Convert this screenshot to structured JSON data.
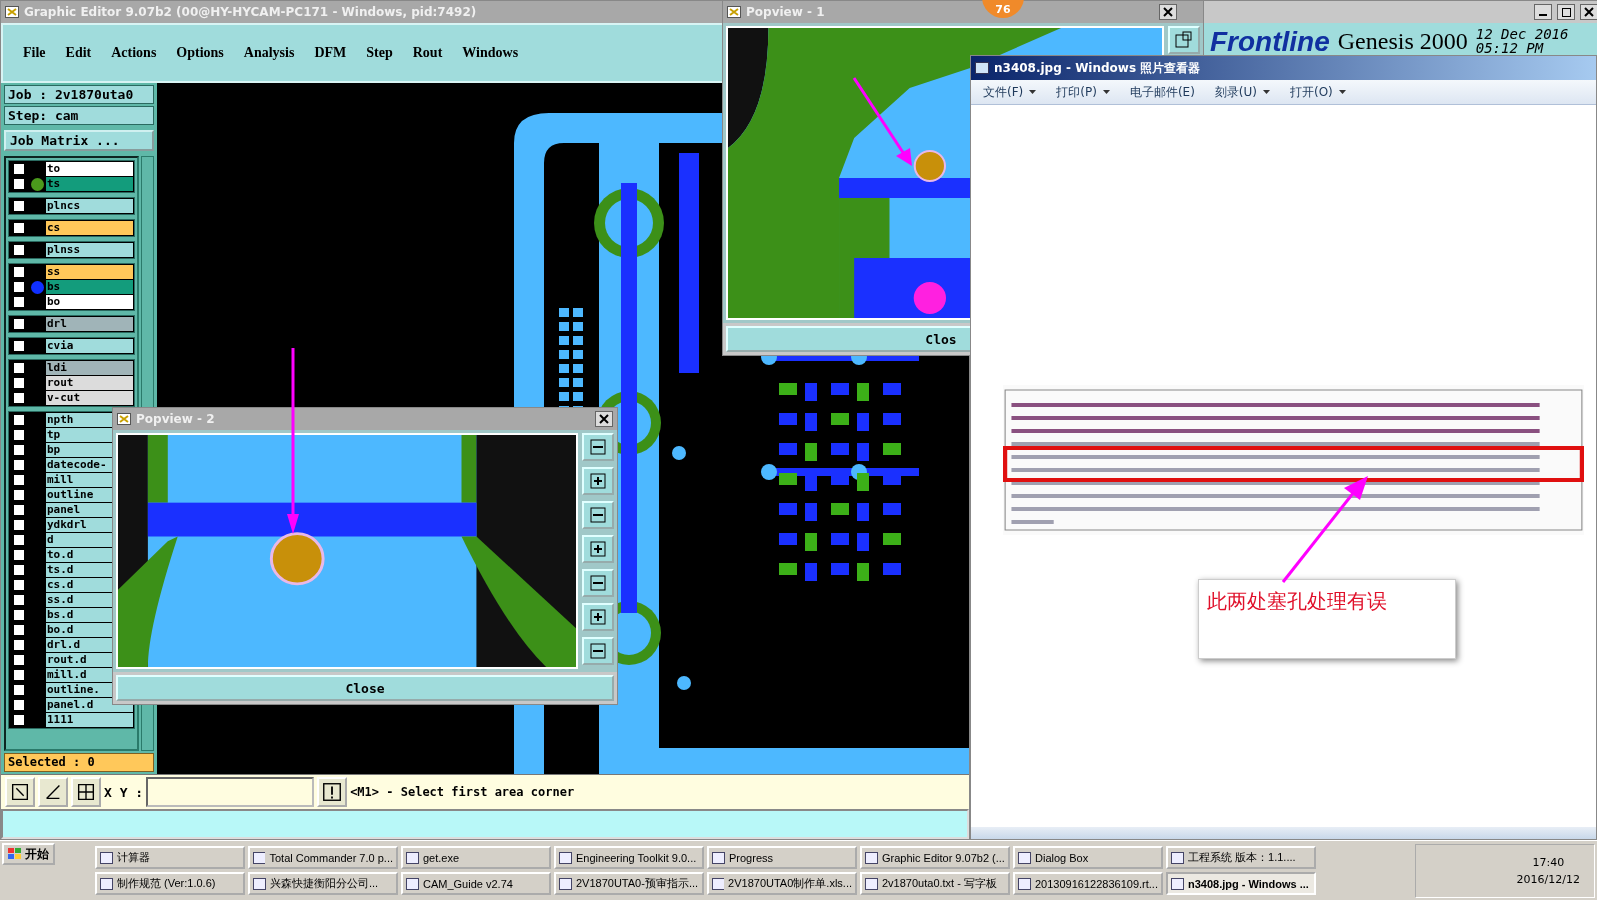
{
  "main_window": {
    "title": "Graphic Editor 9.07b2 (00@HY-HYCAM-PC171 - Windows, pid:7492)",
    "menu": [
      "File",
      "Edit",
      "Actions",
      "Options",
      "Analysis",
      "DFM",
      "Step",
      "Rout",
      "Windows"
    ],
    "job": "Job : 2v1870uta0",
    "step": "Step: cam",
    "job_matrix_button": "Job Matrix ...",
    "layer_groups": [
      {
        "layers": [
          {
            "name": "to",
            "color": "#ffffff",
            "checked": false
          },
          {
            "name": "ts",
            "color": "#139c7c",
            "checked": false,
            "marker": {
              "color": "#4a9a1c"
            }
          }
        ]
      },
      {
        "layers": [
          {
            "name": "plncs",
            "color": "#a0dcdc",
            "checked": false
          }
        ]
      },
      {
        "layers": [
          {
            "name": "cs",
            "color": "#ffc85a",
            "checked": false
          }
        ]
      },
      {
        "layers": [
          {
            "name": "plnss",
            "color": "#a0dcdc",
            "checked": false
          }
        ]
      },
      {
        "layers": [
          {
            "name": "ss",
            "color": "#ffc85a",
            "checked": false
          },
          {
            "name": "bs",
            "color": "#139c7c",
            "checked": false,
            "marker": {
              "color": "#1030ff"
            }
          },
          {
            "name": "bo",
            "color": "#ffffff",
            "checked": false
          }
        ]
      },
      {
        "layers": [
          {
            "name": "drl",
            "color": "#a0b4b8",
            "checked": false
          }
        ]
      },
      {
        "layers": [
          {
            "name": "cvia",
            "color": "#a0dcdc",
            "checked": false
          }
        ]
      },
      {
        "layers": [
          {
            "name": "ldi",
            "color": "#a0b4b8",
            "checked": false
          },
          {
            "name": "rout",
            "color": "#dcdcdc",
            "checked": false
          },
          {
            "name": "v-cut",
            "color": "#dcdcdc",
            "checked": false
          }
        ]
      },
      {
        "layers": [
          {
            "name": "npth",
            "color": "#a0dcdc",
            "checked": false
          },
          {
            "name": "tp",
            "color": "#a0dcdc",
            "checked": false
          },
          {
            "name": "bp",
            "color": "#a0dcdc",
            "checked": false
          },
          {
            "name": "datecode-",
            "color": "#a0dcdc",
            "checked": false
          },
          {
            "name": "mill",
            "color": "#a0dcdc",
            "checked": false
          },
          {
            "name": "outline",
            "color": "#a0dcdc",
            "checked": false
          },
          {
            "name": "panel",
            "color": "#a0dcdc",
            "checked": false
          },
          {
            "name": "ydkdrl",
            "color": "#a0dcdc",
            "checked": false
          },
          {
            "name": "d",
            "color": "#a0dcdc",
            "checked": false
          },
          {
            "name": "to.d",
            "color": "#a0dcdc",
            "checked": false
          },
          {
            "name": "ts.d",
            "color": "#a0dcdc",
            "checked": false
          },
          {
            "name": "cs.d",
            "color": "#a0dcdc",
            "checked": false
          },
          {
            "name": "ss.d",
            "color": "#a0dcdc",
            "checked": false
          },
          {
            "name": "bs.d",
            "color": "#a0dcdc",
            "checked": false
          },
          {
            "name": "bo.d",
            "color": "#a0dcdc",
            "checked": false
          },
          {
            "name": "drl.d",
            "color": "#a0dcdc",
            "checked": false
          },
          {
            "name": "rout.d",
            "color": "#a0dcdc",
            "checked": false
          },
          {
            "name": "mill.d",
            "color": "#a0dcdc",
            "checked": false
          },
          {
            "name": "outline.",
            "color": "#a0dcdc",
            "checked": false
          },
          {
            "name": "panel.d",
            "color": "#a0dcdc",
            "checked": false
          },
          {
            "name": "1111",
            "color": "#a0dcdc",
            "checked": false
          }
        ]
      }
    ],
    "selected": "Selected : 0",
    "xy_label": "X Y :",
    "prompt": "<M1> - Select first area corner"
  },
  "popviews": [
    {
      "title": "Popview - 1",
      "close": "Clos"
    },
    {
      "title": "Popview - 2",
      "close": "Close"
    }
  ],
  "badge": "76",
  "genesis": {
    "logo": "Frontline",
    "title": "Genesis 2000",
    "date": "12 Dec 2016",
    "time": "05:12 PM"
  },
  "photo_viewer": {
    "title": "n3408.jpg - Windows 照片查看器",
    "menu": [
      "文件(F)",
      "打印(P)",
      "电子邮件(E)",
      "刻录(U)",
      "打开(O)"
    ],
    "annotation": "此两处塞孔处理有误"
  },
  "taskbar": {
    "start": "开始",
    "rows": [
      [
        {
          "label": "计算器",
          "selected": false
        },
        {
          "label": "Total Commander 7.0 p...",
          "selected": false
        },
        {
          "label": "get.exe",
          "selected": false
        },
        {
          "label": "Engineering Toolkit 9.0...",
          "selected": false
        },
        {
          "label": "Progress",
          "selected": false
        },
        {
          "label": "Graphic Editor 9.07b2 (...",
          "selected": false
        },
        {
          "label": "Dialog Box",
          "selected": false
        },
        {
          "label": "工程系统  版本：1.1....",
          "selected": false
        }
      ],
      [
        {
          "label": "制作规范 (Ver:1.0.6)",
          "selected": false
        },
        {
          "label": "兴森快捷衡阳分公司...",
          "selected": false
        },
        {
          "label": "CAM_Guide v2.74",
          "selected": false
        },
        {
          "label": "2V1870UTA0-预审指示...",
          "selected": false
        },
        {
          "label": "2V1870UTA0制作单.xls...",
          "selected": false
        },
        {
          "label": "2v1870uta0.txt - 写字板",
          "selected": false
        },
        {
          "label": "20130916122836109.rt...",
          "selected": false
        },
        {
          "label": "n3408.jpg - Windows ...",
          "selected": true
        }
      ]
    ],
    "time": "17:40",
    "date": "2016/12/12"
  }
}
